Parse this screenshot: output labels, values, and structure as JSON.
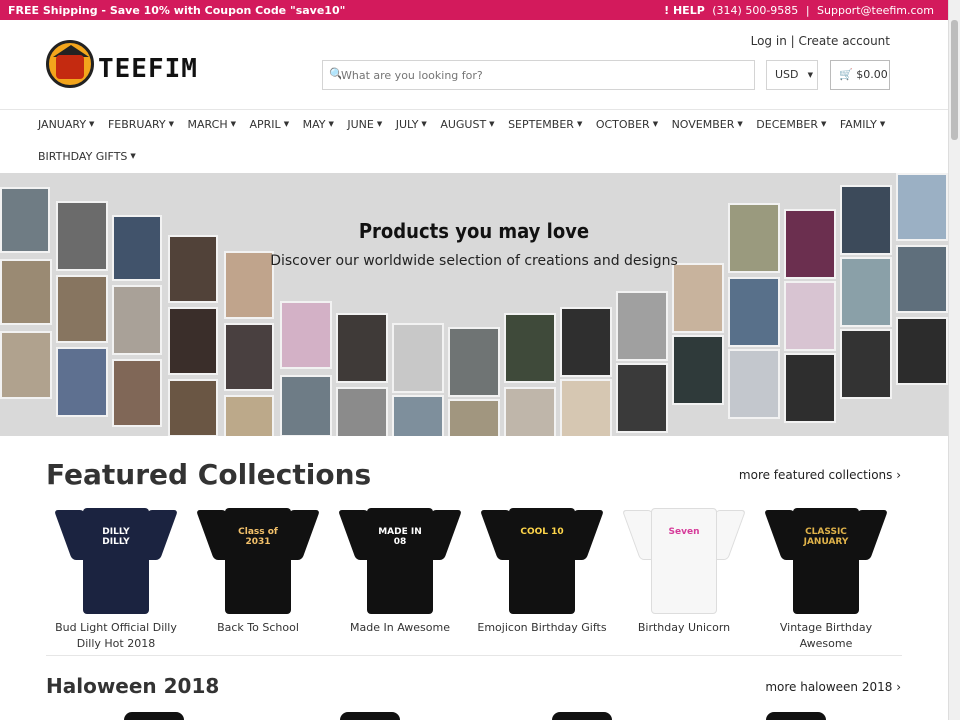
{
  "topbar": {
    "promo": "FREE Shipping - Save 10% with Coupon Code \"save10\"",
    "help": "! HELP",
    "phone": "(314) 500-9585",
    "email": "Support@teefim.com"
  },
  "header": {
    "brand": "TEEFIM",
    "login": "Log in",
    "separator": "|",
    "create_account": "Create account",
    "search_placeholder": "What are you looking for?",
    "currency": "USD",
    "cart_total": "$0.00"
  },
  "nav": {
    "items": [
      "JANUARY",
      "FEBRUARY",
      "MARCH",
      "APRIL",
      "MAY",
      "JUNE",
      "JULY",
      "AUGUST",
      "SEPTEMBER",
      "OCTOBER",
      "NOVEMBER",
      "DECEMBER",
      "FAMILY",
      "BIRTHDAY GIFTS"
    ]
  },
  "banner": {
    "title": "Products you may love",
    "subtitle": "Discover our worldwide selection of creations and designs"
  },
  "featured": {
    "title": "Featured Collections",
    "more": "more featured collections ›",
    "cards": [
      {
        "label": "Bud Light Official Dilly Dilly Hot 2018",
        "shirt_color": "#1b2340",
        "print": "DILLY DILLY",
        "print_color": "#ffffff"
      },
      {
        "label": "Back To School",
        "shirt_color": "#111111",
        "print": "Class of 2031",
        "print_color": "#f4c26b"
      },
      {
        "label": "Made In Awesome",
        "shirt_color": "#111111",
        "print": "MADE IN 08",
        "print_color": "#ffffff"
      },
      {
        "label": "Emojicon Birthday Gifts",
        "shirt_color": "#111111",
        "print": "COOL 10",
        "print_color": "#ffd64a"
      },
      {
        "label": "Birthday Unicorn",
        "shirt_color": "#f7f7f7",
        "print": "Seven",
        "print_color": "#d63b9a"
      },
      {
        "label": "Vintage Birthday Awesome",
        "shirt_color": "#111111",
        "print": "CLASSIC JANUARY",
        "print_color": "#e0b34a"
      }
    ]
  },
  "haloween": {
    "title": "Haloween 2018",
    "more": "more haloween 2018 ›"
  }
}
